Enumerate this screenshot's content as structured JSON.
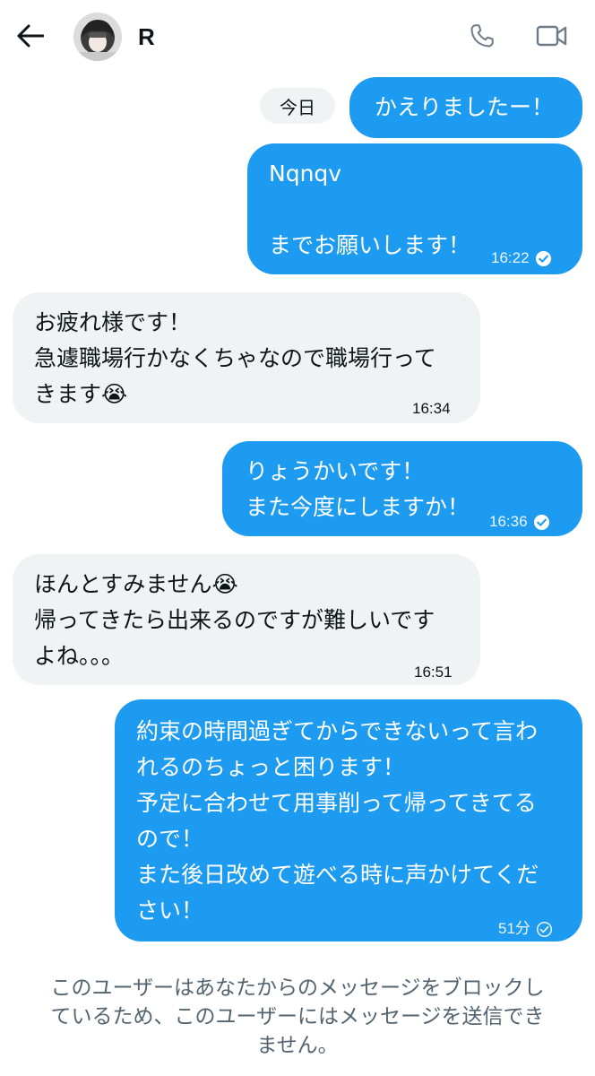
{
  "header": {
    "user_name": "R",
    "back_icon": "arrow-left-icon",
    "call_icon": "phone-icon",
    "video_icon": "video-camera-icon"
  },
  "date_chip": "今日",
  "messages": [
    {
      "direction": "outgoing",
      "text": "かえりましたー！",
      "time": ""
    },
    {
      "direction": "outgoing",
      "text": "Nqnqv\n\nまでお願いします！",
      "time": "16:22",
      "status": "read"
    },
    {
      "direction": "incoming",
      "text": "お疲れ様です！\n急遽職場行かなくちゃなので職場行って\nきます😭",
      "time": "16:34"
    },
    {
      "direction": "outgoing",
      "text": "りょうかいです！\nまた今度にしますか！",
      "time": "16:36",
      "status": "read"
    },
    {
      "direction": "incoming",
      "text": "ほんとすみません😭\n帰ってきたら出来るのですが難しいです\nよね。。。",
      "time": "16:51"
    },
    {
      "direction": "outgoing",
      "text": "約束の時間過ぎてからできないって言わ\nれるのちょっと困ります！\n予定に合わせて用事削って帰ってきてる\nので！\nまた後日改めて遊べる時に声かけてくだ\nさい！",
      "time": "51分",
      "status": "sent"
    }
  ],
  "blocked_notice": "このユーザーはあなたからのメッセージをブロックし\nているため、このユーザーにはメッセージを送信でき\nません。",
  "colors": {
    "outgoing_bubble": "#1d9bf0",
    "incoming_bubble": "#eff3f4",
    "muted_text": "#536471"
  }
}
